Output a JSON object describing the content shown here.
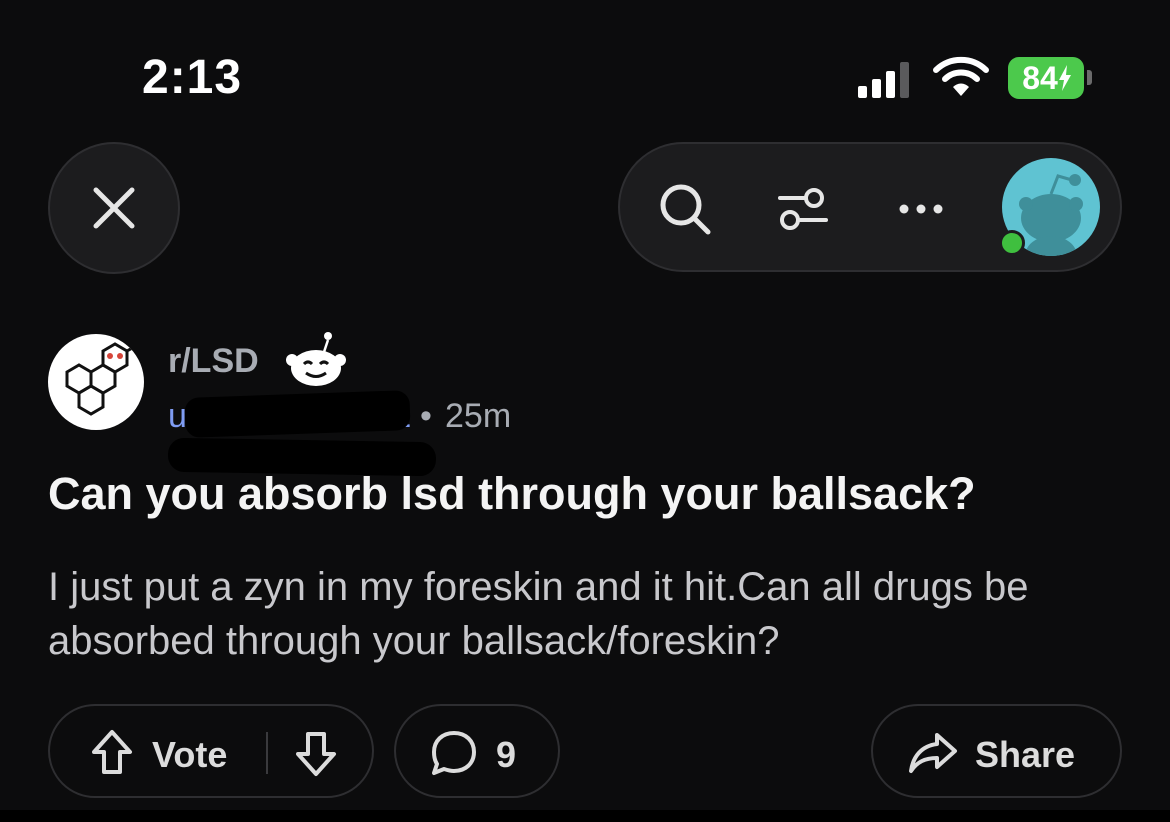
{
  "status_bar": {
    "time": "2:13",
    "battery_level": "84",
    "battery_charging": true,
    "battery_color": "#4cc94c",
    "signal_icon": "signal-bars-icon",
    "wifi_icon": "wifi-icon"
  },
  "nav": {
    "close_icon": "close-icon",
    "search_icon": "search-icon",
    "filter_icon": "filter-icon",
    "more_icon": "more-horizontal-icon",
    "avatar_status": "online"
  },
  "post": {
    "subreddit": "r/LSD",
    "author_prefix": "u/",
    "author_visible_suffix": "1",
    "separator": "•",
    "age": "25m",
    "title": "Can you absorb lsd through your ballsack?",
    "body": "I just put a zyn in my foreskin and it hit.Can all drugs be absorbed through your ballsack/foreskin?"
  },
  "actions": {
    "vote_label": "Vote",
    "comment_count": "9",
    "share_label": "Share"
  },
  "colors": {
    "background": "#0c0c0d",
    "author_link": "#7f9cf2",
    "online_dot": "#3fbf3f",
    "avatar_bg": "#5fc3d2"
  }
}
